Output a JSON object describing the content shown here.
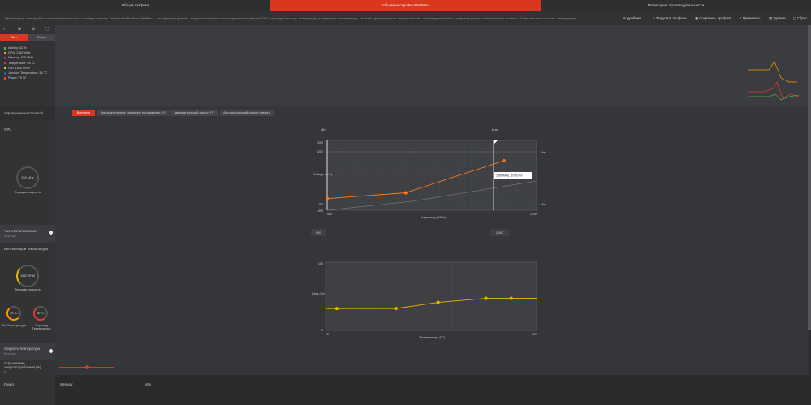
{
  "tabs": [
    "Общая графика",
    "Общие настройки WattMan",
    "Мониторинг производительности"
  ],
  "info_text": "Просмотрите и настройте скорость вентилятора и тактовую частоту. Технология Radeon WattMan — это функция разгона, которая позволяет контролировать активность GPU, тактовую частоту, температуру и параметры вентилятора. На этой странице можно оптимизировать производительность графики в рамках возможностей системы. Более высокие частоты, температура ...",
  "toolbar": {
    "more": "подробнее...",
    "load": "Загрузить профиль",
    "save": "Сохранить профиль",
    "apply": "Применить",
    "delete": "Удалить",
    "reset": "Сброс"
  },
  "left_tabs": [
    "Лин",
    "Сетка"
  ],
  "legend": [
    {
      "label": "Activity: 32 %",
      "color": "#4caf50"
    },
    {
      "label": "GPU: 1182 MHz",
      "color": "#ff9800"
    },
    {
      "label": "Memory: 875 MHz",
      "color": "#9c27b0"
    },
    {
      "label": "Temperature: 54 °C",
      "color": "#e53935"
    },
    {
      "label": "Fan: 1600 RPM",
      "color": "#ffc107"
    },
    {
      "label": "Junction Temperature: 56 °C",
      "color": "#3f51b5"
    },
    {
      "label": "Power: 75 W",
      "color": "#f44336"
    }
  ],
  "sections": {
    "control": "Управление настройкой",
    "gpu": "GPU",
    "freq_volt": "Частота/напряжение",
    "freq_volt_sub": "Вручную",
    "fan_temp": "Вентилятор и температура",
    "speed_temp": "Скорость/температура",
    "speed_temp_sub": "Вручную",
    "power_limit": "Ограничение энергопотребления (%)",
    "power_limit_value": "0",
    "power": "Power",
    "memory": "Memory",
    "max": "Max"
  },
  "mode_buttons": [
    "Вручную",
    "Автоматическое снижение напряжения (?)",
    "Автоматический разгон (?)",
    "Автоматический разгон памяти"
  ],
  "gauges": {
    "gpu_speed": {
      "value": "253 MHz",
      "label": "Текущая скорость"
    },
    "fan_speed": {
      "value": "1582 RPM",
      "label": "Текущая скорость"
    },
    "temp": {
      "value": "54 °C",
      "label": "Ток Температура"
    },
    "junction": {
      "value": "56 °C",
      "label": "Переход Температура"
    }
  },
  "volt_chart": {
    "min_label": "Min",
    "max_label": "Max",
    "y_ticks": [
      "1250",
      "1200",
      "750",
      "650"
    ],
    "x_ticks": [
      "500",
      "2100"
    ],
    "ylabel": "Voltage (mV)",
    "xlabel": "Frequency (MHz)",
    "max_line": "Max",
    "min_line": "Min",
    "tooltip": "1850 MHz, 1076 mV",
    "min_value": "500",
    "max_value": "1850"
  },
  "chart_data": [
    {
      "type": "line",
      "title": "",
      "xlabel": "Frequency (MHz)",
      "ylabel": "Voltage (mV)",
      "xlim": [
        500,
        2100
      ],
      "ylim": [
        650,
        1250
      ],
      "series": [
        {
          "values": [
            [
              500,
              750
            ],
            [
              1100,
              800
            ],
            [
              1850,
              1076
            ]
          ]
        }
      ]
    },
    {
      "type": "line",
      "title": "",
      "xlabel": "Температура (°C)",
      "ylabel": "Шум (%)",
      "xlim": [
        25,
        100
      ],
      "ylim": [
        0,
        100
      ],
      "series": [
        {
          "values": [
            [
              29,
              32
            ],
            [
              50,
              32
            ],
            [
              65,
              41
            ],
            [
              82,
              47
            ],
            [
              91,
              47
            ]
          ]
        }
      ]
    }
  ],
  "fan_chart": {
    "ylabel": "Шум (%)",
    "xlabel": "Температура (°C)",
    "y_top": "100",
    "y_bottom": "0",
    "x_left": "25",
    "x_right": "100"
  }
}
